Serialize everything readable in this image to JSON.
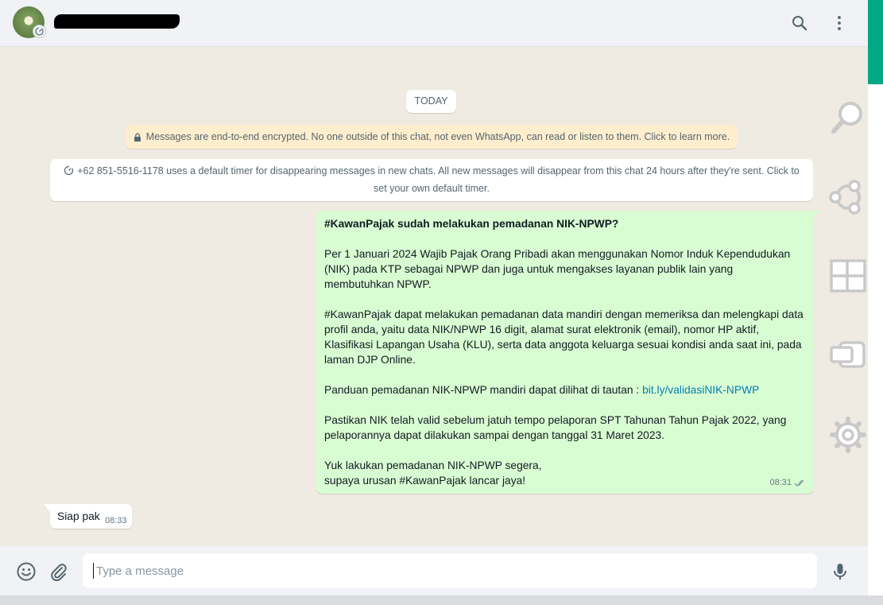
{
  "header": {
    "contact_name": "",
    "search_icon": "search-icon",
    "menu_icon": "menu-icon"
  },
  "chat": {
    "date_label": "TODAY",
    "encryption_notice": "Messages are end-to-end encrypted. No one outside of this chat, not even WhatsApp, can read or listen to them. Click to learn more.",
    "timer_notice": "+62 851-5516-1178 uses a default timer for disappearing messages in new chats. All new messages will disappear from this chat 24 hours after they're sent. Click to set your own default timer.",
    "outgoing": {
      "title": "#KawanPajak sudah melakukan pemadanan NIK-NPWP?",
      "para1": "Per 1 Januari 2024 Wajib Pajak Orang Pribadi akan menggunakan Nomor Induk Kependudukan (NIK) pada KTP sebagai NPWP dan juga untuk mengakses layanan publik lain yang membutuhkan NPWP.",
      "para2": "#KawanPajak dapat melakukan pemadanan data mandiri dengan memeriksa dan melengkapi data profil anda, yaitu data NIK/NPWP 16 digit, alamat surat elektronik (email), nomor HP aktif, Klasifikasi Lapangan Usaha (KLU), serta data anggota keluarga sesuai kondisi anda saat ini, pada laman DJP Online.",
      "para3_text": "Panduan pemadanan NIK-NPWP mandiri dapat dilihat di tautan : ",
      "para3_link": "bit.ly/validasiNIK-NPWP",
      "para4": "Pastikan NIK telah valid sebelum jatuh tempo pelaporan SPT Tahunan Tahun Pajak 2022, yang pelaporannya dapat dilakukan sampai dengan tanggal 31 Maret 2023.",
      "para5_line1": "Yuk lakukan pemadanan NIK-NPWP segera,",
      "para5_line2": "supaya urusan #KawanPajak lancar jaya!",
      "time": "08:31",
      "status": "read"
    },
    "incoming": {
      "text": "Siap pak",
      "time": "08:33"
    }
  },
  "composer": {
    "placeholder": "Type a message",
    "emoji_icon": "emoji-icon",
    "attach_icon": "attach-icon",
    "mic_icon": "mic-icon"
  },
  "sidebar": {
    "icons": [
      "magnifier-icon",
      "share-icon",
      "windows-icon",
      "switch-icon",
      "settings-icon"
    ]
  },
  "colors": {
    "outgoing_bubble": "#d9fdd3",
    "incoming_bubble": "#ffffff",
    "chat_background": "#efeae2",
    "accent": "#00a884",
    "link": "#027eb5"
  }
}
